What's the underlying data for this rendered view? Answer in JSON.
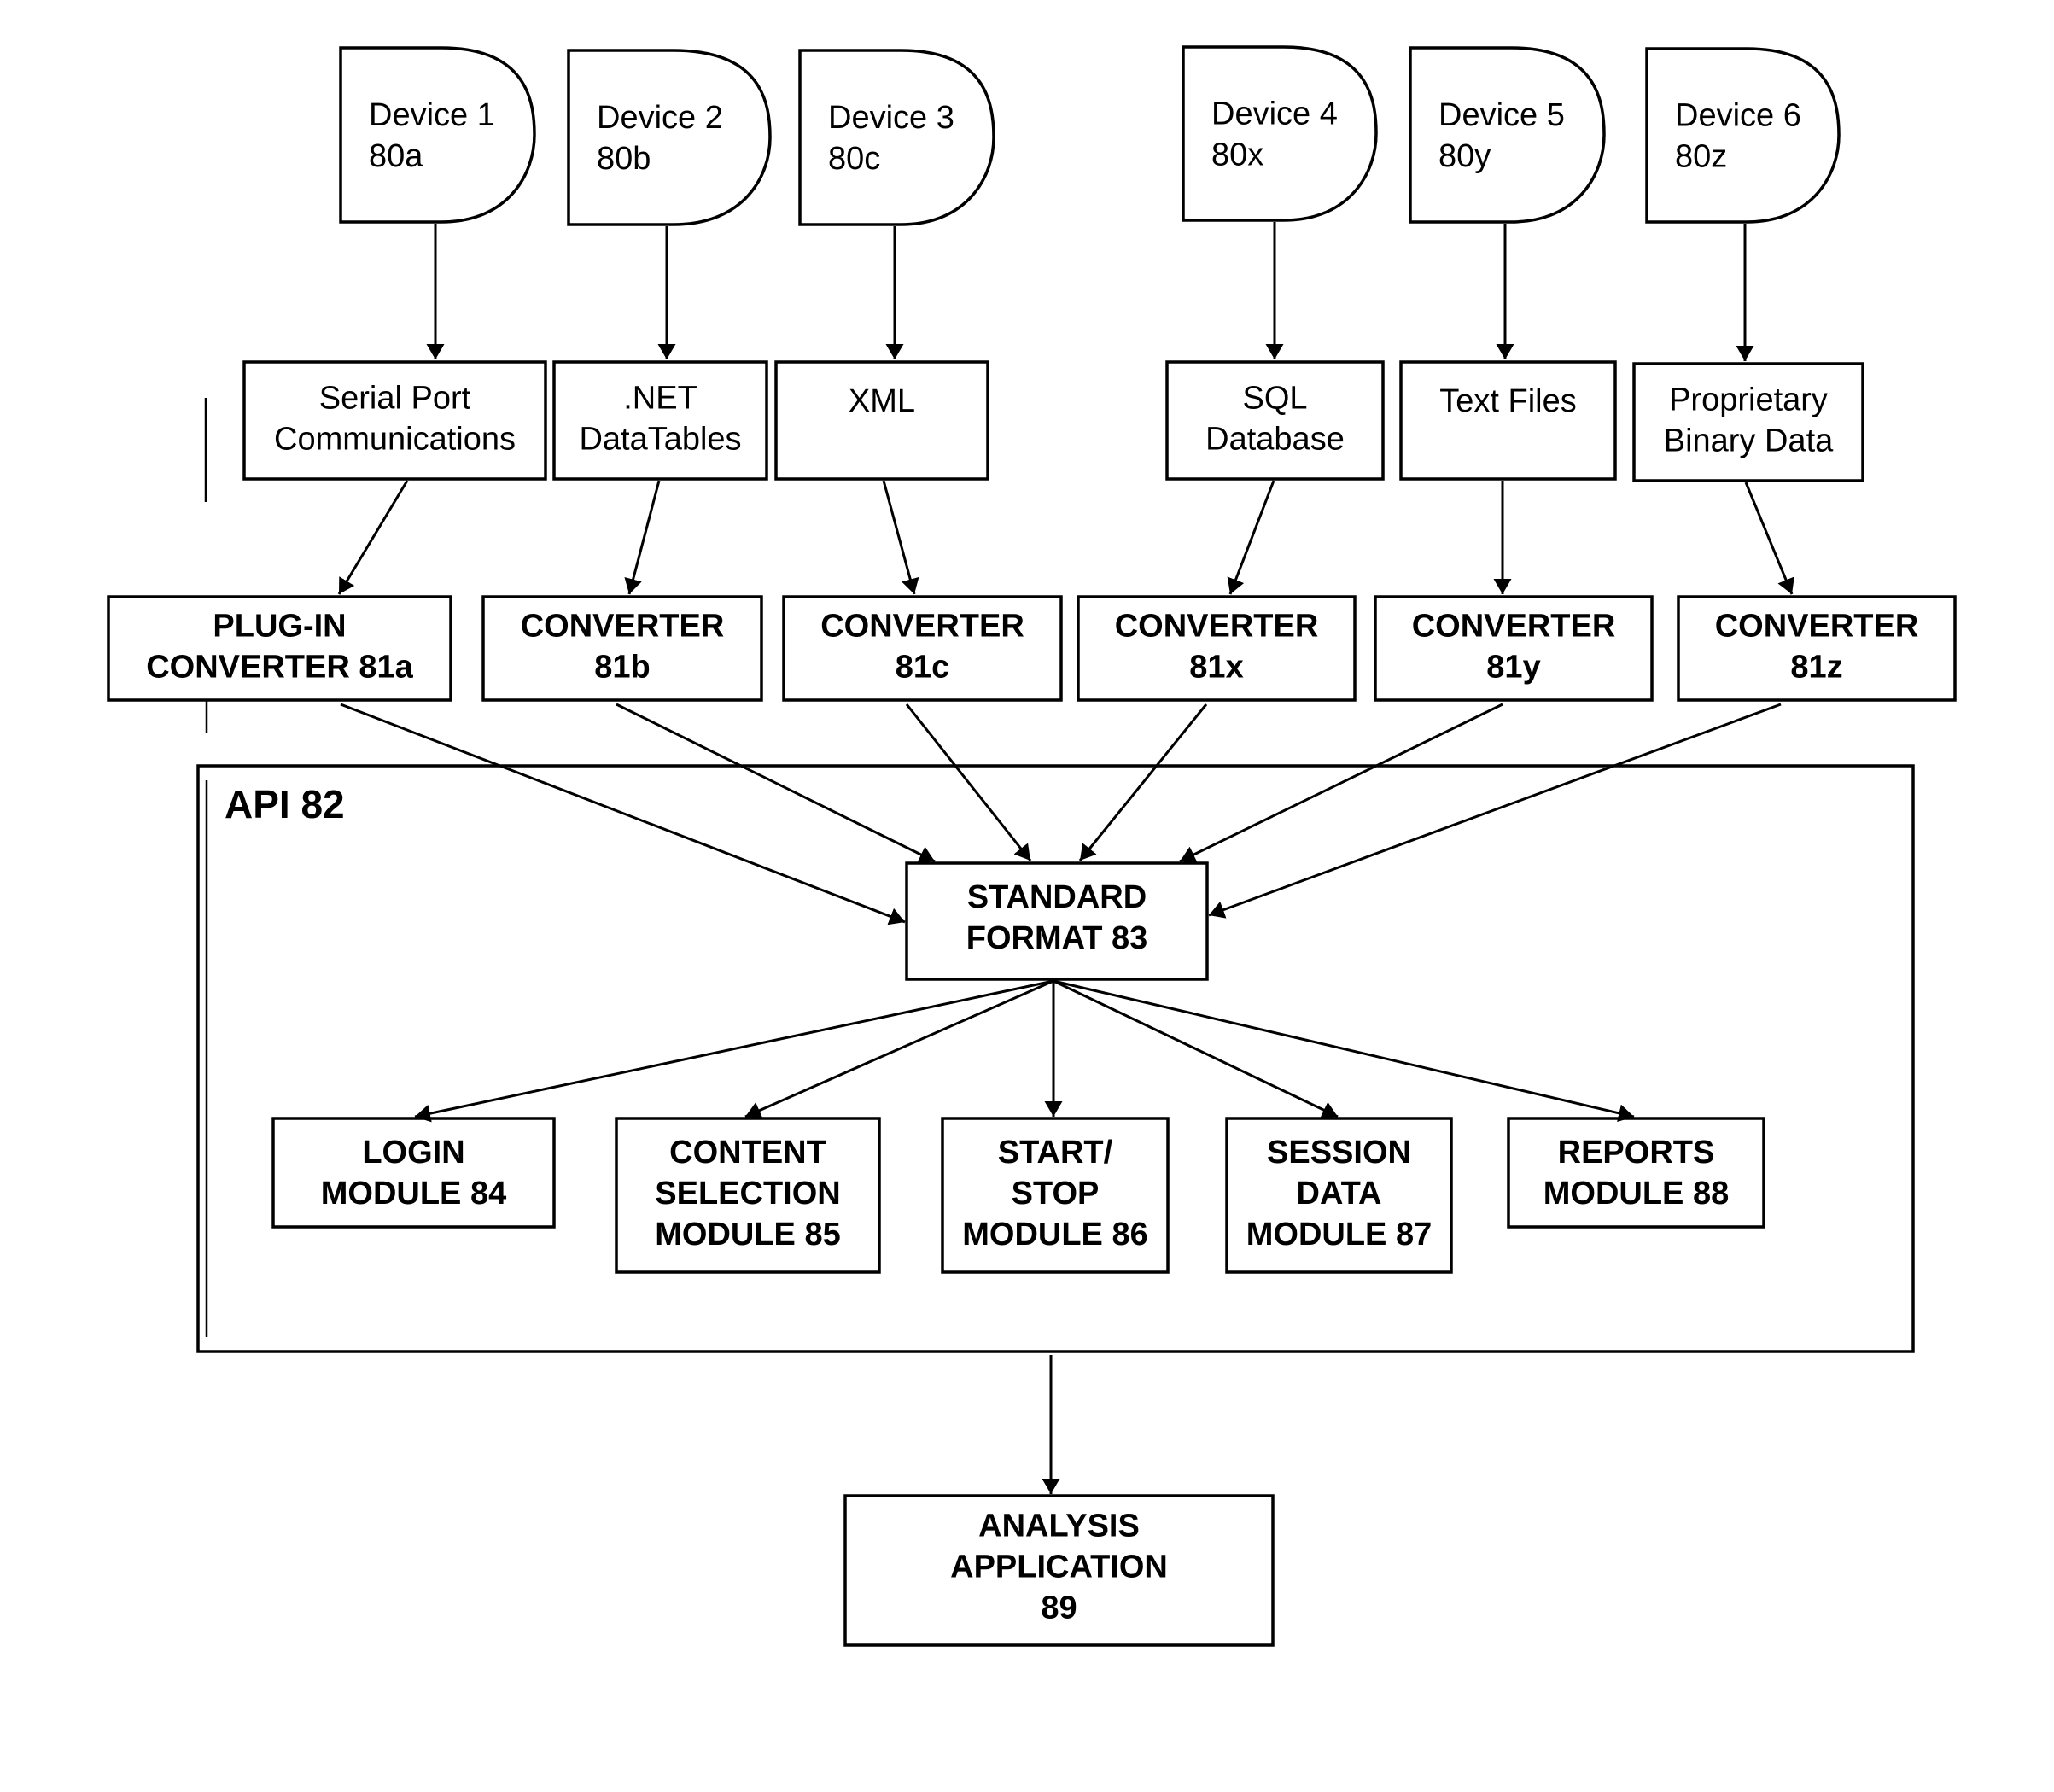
{
  "diagram": {
    "devices": [
      {
        "id": "device-1",
        "lines": [
          "Device 1",
          "80a"
        ]
      },
      {
        "id": "device-2",
        "lines": [
          "Device 2",
          "80b"
        ]
      },
      {
        "id": "device-3",
        "lines": [
          "Device 3",
          "80c"
        ]
      },
      {
        "id": "device-4",
        "lines": [
          "Device 4",
          "80x"
        ]
      },
      {
        "id": "device-5",
        "lines": [
          "Device 5",
          "80y"
        ]
      },
      {
        "id": "device-6",
        "lines": [
          "Device 6",
          "80z"
        ]
      }
    ],
    "data_sources": [
      {
        "id": "serial-port",
        "lines": [
          "Serial Port",
          "Communications"
        ]
      },
      {
        "id": "dotnet-datatables",
        "lines": [
          ".NET",
          "DataTables"
        ]
      },
      {
        "id": "xml",
        "lines": [
          "XML"
        ]
      },
      {
        "id": "sql-database",
        "lines": [
          "SQL",
          "Database"
        ]
      },
      {
        "id": "text-files",
        "lines": [
          "Text Files"
        ]
      },
      {
        "id": "proprietary-binary",
        "lines": [
          "Proprietary",
          "Binary Data"
        ]
      }
    ],
    "converters": [
      {
        "id": "converter-81a",
        "lines": [
          "PLUG-IN",
          "CONVERTER 81a"
        ]
      },
      {
        "id": "converter-81b",
        "lines": [
          "CONVERTER",
          "81b"
        ]
      },
      {
        "id": "converter-81c",
        "lines": [
          "CONVERTER",
          "81c"
        ]
      },
      {
        "id": "converter-81x",
        "lines": [
          "CONVERTER",
          "81x"
        ]
      },
      {
        "id": "converter-81y",
        "lines": [
          "CONVERTER",
          "81y"
        ]
      },
      {
        "id": "converter-81z",
        "lines": [
          "CONVERTER",
          "81z"
        ]
      }
    ],
    "api": {
      "label": "API 82"
    },
    "standard_format": {
      "lines": [
        "STANDARD",
        "FORMAT 83"
      ]
    },
    "modules": [
      {
        "id": "login-module",
        "lines": [
          "LOGIN",
          "MODULE 84"
        ]
      },
      {
        "id": "content-selection-module",
        "lines": [
          "CONTENT",
          "SELECTION",
          "MODULE 85"
        ]
      },
      {
        "id": "start-stop-module",
        "lines": [
          "START/",
          "STOP",
          "MODULE 86"
        ]
      },
      {
        "id": "session-data-module",
        "lines": [
          "SESSION",
          "DATA",
          "MODULE 87"
        ]
      },
      {
        "id": "reports-module",
        "lines": [
          "REPORTS",
          "MODULE 88"
        ]
      }
    ],
    "analysis_application": {
      "lines": [
        "ANALYSIS",
        "APPLICATION",
        "89"
      ]
    }
  }
}
